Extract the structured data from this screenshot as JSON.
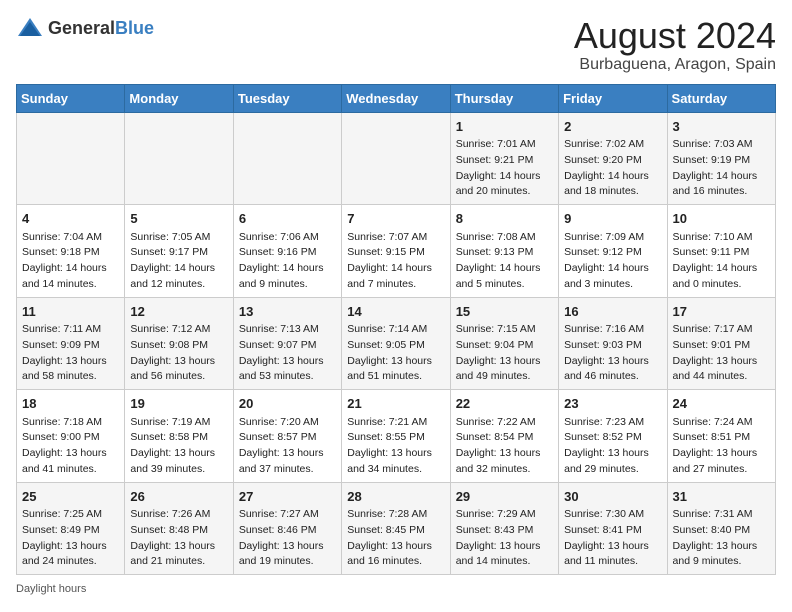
{
  "logo": {
    "general": "General",
    "blue": "Blue"
  },
  "title": "August 2024",
  "location": "Burbaguena, Aragon, Spain",
  "days_of_week": [
    "Sunday",
    "Monday",
    "Tuesday",
    "Wednesday",
    "Thursday",
    "Friday",
    "Saturday"
  ],
  "weeks": [
    [
      {
        "day": "",
        "content": ""
      },
      {
        "day": "",
        "content": ""
      },
      {
        "day": "",
        "content": ""
      },
      {
        "day": "",
        "content": ""
      },
      {
        "day": "1",
        "content": "Sunrise: 7:01 AM\nSunset: 9:21 PM\nDaylight: 14 hours and 20 minutes."
      },
      {
        "day": "2",
        "content": "Sunrise: 7:02 AM\nSunset: 9:20 PM\nDaylight: 14 hours and 18 minutes."
      },
      {
        "day": "3",
        "content": "Sunrise: 7:03 AM\nSunset: 9:19 PM\nDaylight: 14 hours and 16 minutes."
      }
    ],
    [
      {
        "day": "4",
        "content": "Sunrise: 7:04 AM\nSunset: 9:18 PM\nDaylight: 14 hours and 14 minutes."
      },
      {
        "day": "5",
        "content": "Sunrise: 7:05 AM\nSunset: 9:17 PM\nDaylight: 14 hours and 12 minutes."
      },
      {
        "day": "6",
        "content": "Sunrise: 7:06 AM\nSunset: 9:16 PM\nDaylight: 14 hours and 9 minutes."
      },
      {
        "day": "7",
        "content": "Sunrise: 7:07 AM\nSunset: 9:15 PM\nDaylight: 14 hours and 7 minutes."
      },
      {
        "day": "8",
        "content": "Sunrise: 7:08 AM\nSunset: 9:13 PM\nDaylight: 14 hours and 5 minutes."
      },
      {
        "day": "9",
        "content": "Sunrise: 7:09 AM\nSunset: 9:12 PM\nDaylight: 14 hours and 3 minutes."
      },
      {
        "day": "10",
        "content": "Sunrise: 7:10 AM\nSunset: 9:11 PM\nDaylight: 14 hours and 0 minutes."
      }
    ],
    [
      {
        "day": "11",
        "content": "Sunrise: 7:11 AM\nSunset: 9:09 PM\nDaylight: 13 hours and 58 minutes."
      },
      {
        "day": "12",
        "content": "Sunrise: 7:12 AM\nSunset: 9:08 PM\nDaylight: 13 hours and 56 minutes."
      },
      {
        "day": "13",
        "content": "Sunrise: 7:13 AM\nSunset: 9:07 PM\nDaylight: 13 hours and 53 minutes."
      },
      {
        "day": "14",
        "content": "Sunrise: 7:14 AM\nSunset: 9:05 PM\nDaylight: 13 hours and 51 minutes."
      },
      {
        "day": "15",
        "content": "Sunrise: 7:15 AM\nSunset: 9:04 PM\nDaylight: 13 hours and 49 minutes."
      },
      {
        "day": "16",
        "content": "Sunrise: 7:16 AM\nSunset: 9:03 PM\nDaylight: 13 hours and 46 minutes."
      },
      {
        "day": "17",
        "content": "Sunrise: 7:17 AM\nSunset: 9:01 PM\nDaylight: 13 hours and 44 minutes."
      }
    ],
    [
      {
        "day": "18",
        "content": "Sunrise: 7:18 AM\nSunset: 9:00 PM\nDaylight: 13 hours and 41 minutes."
      },
      {
        "day": "19",
        "content": "Sunrise: 7:19 AM\nSunset: 8:58 PM\nDaylight: 13 hours and 39 minutes."
      },
      {
        "day": "20",
        "content": "Sunrise: 7:20 AM\nSunset: 8:57 PM\nDaylight: 13 hours and 37 minutes."
      },
      {
        "day": "21",
        "content": "Sunrise: 7:21 AM\nSunset: 8:55 PM\nDaylight: 13 hours and 34 minutes."
      },
      {
        "day": "22",
        "content": "Sunrise: 7:22 AM\nSunset: 8:54 PM\nDaylight: 13 hours and 32 minutes."
      },
      {
        "day": "23",
        "content": "Sunrise: 7:23 AM\nSunset: 8:52 PM\nDaylight: 13 hours and 29 minutes."
      },
      {
        "day": "24",
        "content": "Sunrise: 7:24 AM\nSunset: 8:51 PM\nDaylight: 13 hours and 27 minutes."
      }
    ],
    [
      {
        "day": "25",
        "content": "Sunrise: 7:25 AM\nSunset: 8:49 PM\nDaylight: 13 hours and 24 minutes."
      },
      {
        "day": "26",
        "content": "Sunrise: 7:26 AM\nSunset: 8:48 PM\nDaylight: 13 hours and 21 minutes."
      },
      {
        "day": "27",
        "content": "Sunrise: 7:27 AM\nSunset: 8:46 PM\nDaylight: 13 hours and 19 minutes."
      },
      {
        "day": "28",
        "content": "Sunrise: 7:28 AM\nSunset: 8:45 PM\nDaylight: 13 hours and 16 minutes."
      },
      {
        "day": "29",
        "content": "Sunrise: 7:29 AM\nSunset: 8:43 PM\nDaylight: 13 hours and 14 minutes."
      },
      {
        "day": "30",
        "content": "Sunrise: 7:30 AM\nSunset: 8:41 PM\nDaylight: 13 hours and 11 minutes."
      },
      {
        "day": "31",
        "content": "Sunrise: 7:31 AM\nSunset: 8:40 PM\nDaylight: 13 hours and 9 minutes."
      }
    ]
  ],
  "footer": "Daylight hours"
}
